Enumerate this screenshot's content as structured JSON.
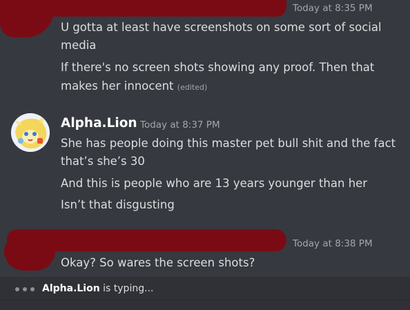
{
  "messages": [
    {
      "author_redacted": true,
      "timestamp": "Today at 8:35 PM",
      "lines": [
        "U gotta at least have screenshots on some sort of social",
        "media",
        "If there's no screen shots showing any proof. Then that",
        "makes her innocent"
      ],
      "edited_label": "(edited)"
    },
    {
      "author": "Alpha.Lion",
      "timestamp": "Today at 8:37 PM",
      "lines": [
        "She has people doing this master pet bull shit and the fact",
        "that’s she’s 30",
        "And this is people who are 13 years younger than her",
        "Isn’t that disgusting"
      ]
    },
    {
      "author_redacted": true,
      "timestamp": "Today at 8:38 PM",
      "lines": [
        "Okay? So wares the screen shots?"
      ]
    }
  ],
  "typing": {
    "user": "Alpha.Lion",
    "suffix": " is typing..."
  },
  "colors": {
    "background": "#36393f",
    "typing_bar": "#2f3136",
    "redaction": "#7a0b14",
    "username": "#ffffff",
    "timestamp": "#a3a6aa"
  },
  "icons": {
    "avatar": "lion-avatar-icon",
    "typing": "typing-dots-icon"
  }
}
